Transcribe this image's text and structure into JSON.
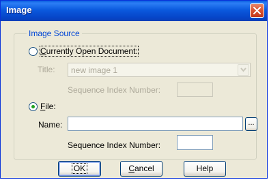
{
  "window": {
    "title": "Image",
    "close_icon": "close-icon"
  },
  "image_source": {
    "legend": "Image Source",
    "current_doc": {
      "label_pre": "C",
      "label_post": "urrently Open Document:",
      "selected": false
    },
    "title": {
      "label": "Title:",
      "value": "new image 1",
      "disabled": true
    },
    "seq_index_disabled": {
      "label": "Sequence Index Number:",
      "value": ""
    },
    "file": {
      "label_pre": "F",
      "label_post": "ile:",
      "selected": true
    },
    "name": {
      "label": "Name:",
      "value": "",
      "browse_label": "..."
    },
    "seq_index": {
      "label": "Sequence Index Number:",
      "value": ""
    }
  },
  "buttons": {
    "ok": "OK",
    "cancel_pre": "C",
    "cancel_post": "ancel",
    "help": "Help"
  },
  "colors": {
    "titlebar": "#0b5ade",
    "legend_text": "#0046d5",
    "radio_dot": "#21a121",
    "close_button": "#d8512f"
  }
}
